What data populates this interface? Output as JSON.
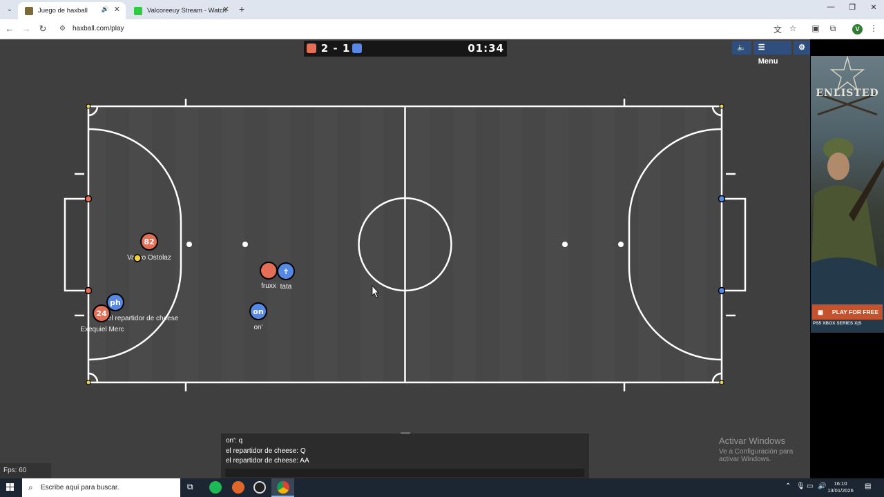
{
  "browser": {
    "tabs": [
      {
        "title": "Juego de haxball",
        "active": true,
        "favicon_color": "#7a6a3a"
      },
      {
        "title": "Valcoreeuy Stream - Watch Live",
        "active": false,
        "favicon_color": "#2ecc40"
      }
    ],
    "url": "haxball.com/play",
    "profile_initial": "V"
  },
  "game": {
    "score": "2 - 1",
    "time": "01:34",
    "red_color": "#e56e56",
    "blue_color": "#5689e5",
    "menu_label": "Menu",
    "players": [
      {
        "team": "red",
        "avatar": "82",
        "name": "Vasco Ostolaz"
      },
      {
        "team": "red",
        "avatar": "",
        "name": "fruxx"
      },
      {
        "team": "blue",
        "avatar": "✝",
        "name": "tata"
      },
      {
        "team": "blue",
        "avatar": "on",
        "name": "on'"
      },
      {
        "team": "blue",
        "avatar": "ph",
        "name": "el repartidor de cheese"
      },
      {
        "team": "red",
        "avatar": "24",
        "name": "Exequiel Merc"
      }
    ],
    "chat": [
      "on': q",
      "el repartidor de cheese: Q",
      "el repartidor de cheese: AA"
    ],
    "fps": "Fps: 60"
  },
  "watermark": {
    "line1": "Activar Windows",
    "line2": "Ve a Configuración para activar Windows."
  },
  "ad": {
    "logo": "ENLISTED",
    "cta": "PLAY FOR FREE",
    "platforms": "PS5  XBOX SERIES X|S"
  },
  "taskbar": {
    "search_placeholder": "Escribe aquí para buscar.",
    "time": "16:10",
    "date": "13/01/2026"
  }
}
